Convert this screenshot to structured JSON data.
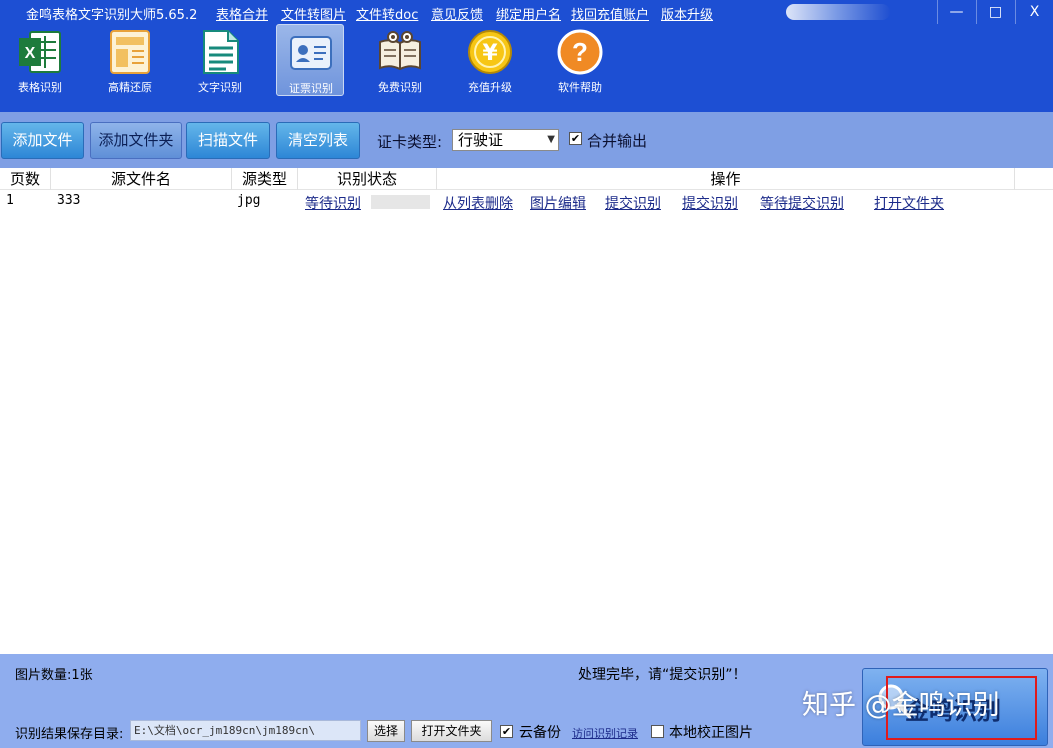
{
  "titlebar": {
    "app_title": "金鸣表格文字识别大师5.65.2",
    "links": [
      "表格合并",
      "文件转图片",
      "文件转doc",
      "意见反馈",
      "绑定用户名",
      "找回充值账户",
      "版本升级"
    ],
    "min_symbol": "—",
    "max_symbol": "□",
    "close_symbol": "X"
  },
  "toolbar": {
    "tools": [
      {
        "label": "表格识别",
        "icon": "excel-icon"
      },
      {
        "label": "高精还原",
        "icon": "document-layout-icon"
      },
      {
        "label": "文字识别",
        "icon": "text-document-icon"
      },
      {
        "label": "证票识别",
        "icon": "id-card-icon",
        "active": true
      },
      {
        "label": "免费识别",
        "icon": "book-icon"
      },
      {
        "label": "充值升级",
        "icon": "yen-coin-icon"
      },
      {
        "label": "软件帮助",
        "icon": "help-icon"
      }
    ]
  },
  "actions": {
    "add_file": "添加文件",
    "add_folder": "添加文件夹",
    "scan_file": "扫描文件",
    "clear_list": "清空列表",
    "card_type_label": "证卡类型:",
    "card_type_value": "行驶证",
    "merge_output_checked": true,
    "merge_output_label": "合并输出"
  },
  "table": {
    "headers": [
      "页数",
      "源文件名",
      "源类型",
      "识别状态",
      "操作"
    ],
    "rows": [
      {
        "page": "1",
        "filename": "333",
        "type": "jpg",
        "status": "等待识别",
        "progress": 0,
        "ops": [
          "从列表删除",
          "图片编辑",
          "提交识别",
          "提交识别",
          "等待提交识别",
          "打开文件夹"
        ]
      }
    ]
  },
  "bottom": {
    "image_count": "图片数量:1张",
    "status_message": "处理完毕，请“提交识别”！",
    "save_dir_label": "识别结果保存目录:",
    "save_dir_value": "E:\\文档\\ocr_jm189cn\\jm189cn\\",
    "choose_button": "选择",
    "open_folder_button": "打开文件夹",
    "cloud_backup_checked": true,
    "cloud_backup_label": "云备份",
    "visit_records_link": "访问识别记录",
    "local_correct_checked": false,
    "local_correct_label": "本地校正图片",
    "recognize_button": "金鸣识别",
    "watermark": "知乎 @金鸣识别"
  },
  "colors": {
    "titlebar_bg": "#1d4fd3",
    "actionbar_bg": "#7f9fe4",
    "bottom_bg": "#8fadee",
    "highlight_box": "#e01b1b",
    "link": "#1c2b8a"
  }
}
